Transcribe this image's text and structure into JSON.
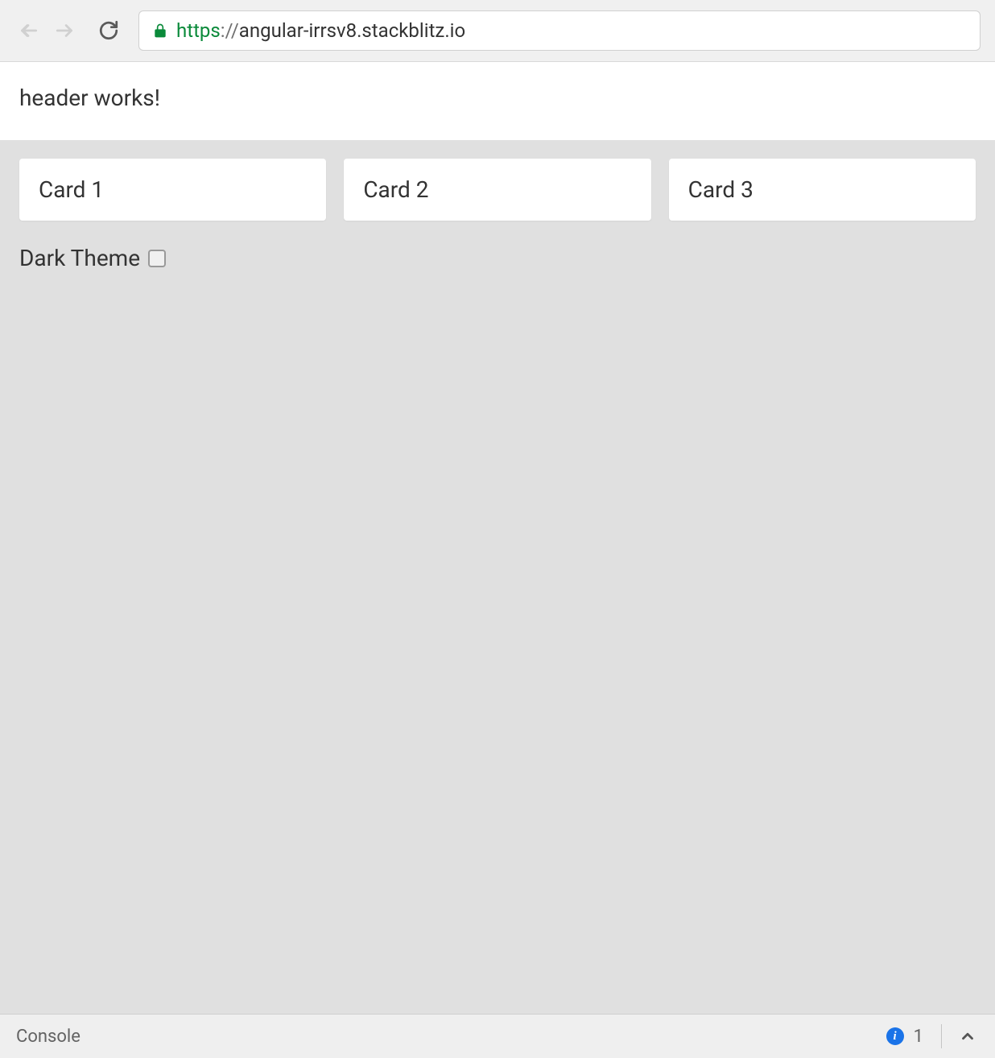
{
  "browser": {
    "url_scheme": "https",
    "url_sep": "://",
    "url_rest": "angular-irrsv8.stackblitz.io"
  },
  "header": {
    "text": "header works!"
  },
  "cards": [
    {
      "title": "Card 1"
    },
    {
      "title": "Card 2"
    },
    {
      "title": "Card 3"
    }
  ],
  "theme": {
    "label": "Dark Theme",
    "checked": false
  },
  "console": {
    "label": "Console",
    "info_count": "1"
  }
}
